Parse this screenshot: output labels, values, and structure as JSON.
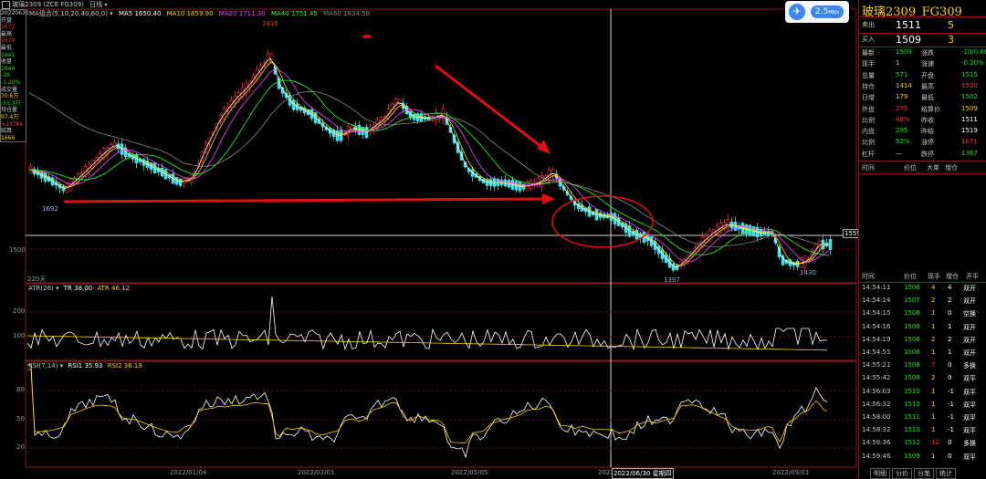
{
  "header": {
    "instrument_icon": "grid-icon",
    "contract": "玻璃2309 (ZCE FG309)",
    "period": "日线",
    "ma_title": "MA组合(5,10,20,40,60,0)",
    "ma5": "MA5 1650.40",
    "ma10": "MA10 1659.90",
    "ma20": "MA20 1711.30",
    "ma40": "MA40 1751.45",
    "ma60": "MA60 1834.58"
  },
  "left_info": [
    "20220630",
    "开盘",
    "1672",
    "最高",
    "1679",
    "最低",
    "1641",
    "收盘",
    "1644",
    "-28",
    "-1.20%",
    "成交量",
    "70.6万",
    "-55.3万",
    "持仓量",
    "97.4万",
    "+23784",
    "结算",
    "1666"
  ],
  "price_chart": {
    "high_label": "2416",
    "low_label_1": "1692",
    "low_label_2": "1397",
    "low_label_3": "1430",
    "axis_1500": "1500",
    "last_price": "1559",
    "days_label": "220天"
  },
  "atr": {
    "title": "ATR(26)",
    "tr": "TR 38.00",
    "atr": "ATR 46.12",
    "ticks": [
      "200",
      "100"
    ]
  },
  "rsi": {
    "title": "RSI(7,14)",
    "rsi1": "RSI1 35.93",
    "rsi2": "RSI2 36.19",
    "ticks": [
      "80",
      "50",
      "20"
    ]
  },
  "x_axis": [
    "2022/01/04",
    "2022/03/01",
    "2022/05/05",
    "2022",
    "2022/06/30 星期四",
    "2022/09/01"
  ],
  "widget": {
    "speed": "2.5",
    "unit": "MB/s"
  },
  "ime_bar": {
    "logo": "S",
    "items": [
      "中",
      "·,",
      "☺",
      "▤",
      "▦",
      "⌨"
    ]
  },
  "quote": {
    "name": "玻璃2309",
    "code": "FG309",
    "sell": {
      "label": "卖出",
      "price": "1511",
      "vol": "5"
    },
    "buy": {
      "label": "买入",
      "price": "1509",
      "vol": "3"
    },
    "stats": [
      [
        "最新",
        "1509",
        "涨跌",
        "-10/0.66%"
      ],
      [
        "现手",
        "1",
        "涨速",
        "-0.20%"
      ],
      [
        "总量",
        "571",
        "开盘",
        "1515"
      ],
      [
        "持仓",
        "1414",
        "最高",
        "1520"
      ],
      [
        "日增",
        "179",
        "最低",
        "1502"
      ],
      [
        "外盘",
        "276",
        "结算价",
        "1509"
      ],
      [
        "比例",
        "48%",
        "昨收",
        "1511"
      ],
      [
        "内盘",
        "295",
        "昨结",
        "1519"
      ],
      [
        "比例",
        "52%",
        "涨停",
        "1671"
      ],
      [
        "杠杆",
        "—",
        "跌停",
        "1367"
      ]
    ],
    "tick_headers_1": [
      "时间",
      "价位",
      "大单",
      "增仓"
    ],
    "tick_headers_2": [
      "时间",
      "价位",
      "现手",
      "增仓",
      "开平"
    ],
    "ticks": [
      [
        "14:54:11",
        "1506",
        "4",
        "4",
        "双开"
      ],
      [
        "14:54:14",
        "1507",
        "2",
        "2",
        "双开"
      ],
      [
        "14:54:15",
        "1506",
        "1",
        "0",
        "空换"
      ],
      [
        "14:54:16",
        "1506",
        "1",
        "1",
        "双开"
      ],
      [
        "14:54:19",
        "1506",
        "2",
        "2",
        "双开"
      ],
      [
        "14:54:55",
        "1508",
        "1",
        "1",
        "双开"
      ],
      [
        "14:55:21",
        "1508",
        "7",
        "0",
        "多换"
      ],
      [
        "14:55:42",
        "1508",
        "2",
        "0",
        "双平"
      ],
      [
        "14:56:03",
        "1510",
        "1",
        "-1",
        "双平"
      ],
      [
        "14:56:32",
        "1510",
        "1",
        "-1",
        "双平"
      ],
      [
        "14:58:00",
        "1511",
        "1",
        "-1",
        "双平"
      ],
      [
        "14:58:32",
        "1510",
        "1",
        "-1",
        "双平"
      ],
      [
        "14:58:36",
        "1512",
        "12",
        "0",
        "多换"
      ],
      [
        "14:59:46",
        "1509",
        "1",
        "0",
        "双平"
      ]
    ],
    "tabs": [
      "明细",
      "分价",
      "分笔",
      "统计"
    ]
  }
}
